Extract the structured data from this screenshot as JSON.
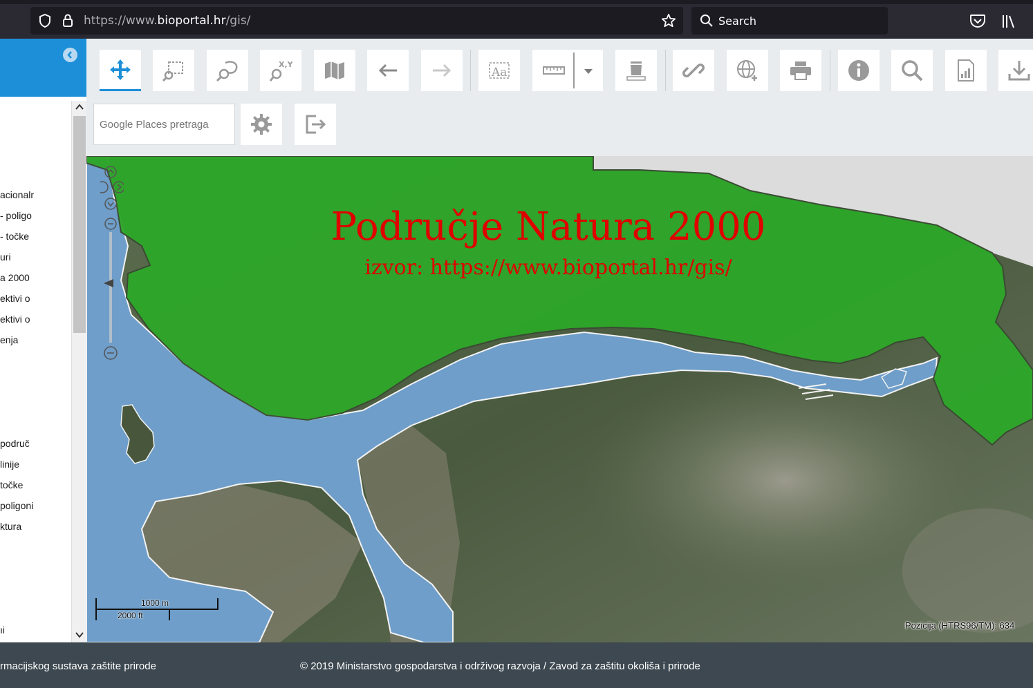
{
  "browser": {
    "url_prefix": "https://www.",
    "url_domain": "bioportal.hr",
    "url_path": "/gis/",
    "search_label": "Search"
  },
  "sidebar": {
    "layers": [
      "acionalr",
      "- poligo",
      "- točke",
      "uri",
      "a 2000",
      "ektivi o",
      "ektivi o",
      "enja",
      "područ",
      "linije",
      "točke",
      "poligoni",
      "ktura",
      "ıi"
    ]
  },
  "toolbar": {
    "search_placeholder": "Google Places pretraga",
    "tools": [
      {
        "name": "pan-tool",
        "icon": "move-icon"
      },
      {
        "name": "zoom-box-tool",
        "icon": "zoom-rectangle-icon"
      },
      {
        "name": "zoom-area-tool",
        "icon": "zoom-lasso-icon"
      },
      {
        "name": "zoom-xy-tool",
        "icon": "xy-zoom-icon"
      },
      {
        "name": "full-extent-tool",
        "icon": "map-icon"
      },
      {
        "name": "previous-extent-tool",
        "icon": "arrow-left-icon"
      },
      {
        "name": "next-extent-tool",
        "icon": "arrow-right-icon"
      },
      {
        "name": "label-tool",
        "icon": "text-label-icon"
      },
      {
        "name": "measure-tool",
        "icon": "ruler-icon"
      },
      {
        "name": "clear-tool",
        "icon": "trash-icon"
      },
      {
        "name": "link-tool",
        "icon": "link-icon"
      },
      {
        "name": "add-wms-tool",
        "icon": "globe-plus-icon"
      },
      {
        "name": "print-tool",
        "icon": "printer-icon"
      },
      {
        "name": "info-tool",
        "icon": "info-icon"
      },
      {
        "name": "search-tool",
        "icon": "search-icon"
      },
      {
        "name": "report-tool",
        "icon": "report-chart-icon"
      },
      {
        "name": "download-tool",
        "icon": "download-icon"
      }
    ]
  },
  "map": {
    "title": "Područje Natura 2000",
    "subtitle": "izvor: https://www.bioportal.hr/gis/",
    "scale_metric": "1000 m",
    "scale_imperial": "2000 ft",
    "position_label": "Pozicija (HTRS96/TM):  634",
    "natura_color": "#2ea62a",
    "sea_color": "#6e9ec9"
  },
  "footer": {
    "left_text": "rmacijskog sustava zaštite prirode",
    "right_text": "© 2019 Ministarstvo gospodarstva i održivog razvoja / Zavod za zaštitu okoliša i prirode"
  }
}
